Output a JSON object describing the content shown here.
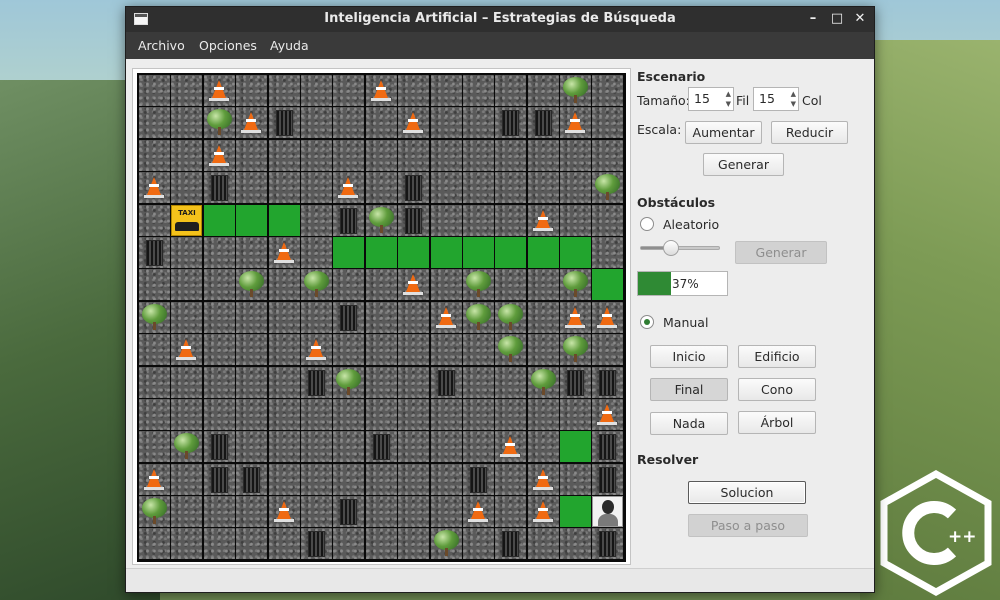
{
  "window": {
    "title": "Inteligencia Artificial – Estrategias de Búsqueda",
    "controls": [
      "minimize",
      "maximize",
      "close"
    ]
  },
  "menu": [
    "Archivo",
    "Opciones",
    "Ayuda"
  ],
  "grid": {
    "rows": 15,
    "cols": 15,
    "legend": {
      ".": "empty",
      "P": "path",
      "C": "cone",
      "T": "tree",
      "B": "building",
      "X": "taxi",
      "F": "person"
    },
    "layout": [
      "..C....C.....T.",
      "..TCB...C..BBC.",
      "..C............",
      "C.B...C.B.....T",
      ".XPPP.BTB...C..",
      "B...C.PPPPPPPP.",
      "...T.T..C.T..TP",
      "T.....B..CTT.CC",
      ".C...C.....T.T.",
      ".....BT..B..TBB",
      "..............C",
      ".TB....B...C.PB",
      "C.BB......B.C.B",
      "T...C.B...C.CPF",
      ".....B...T.B..B"
    ],
    "taxi_label": "TAXI"
  },
  "panel": {
    "escenario_title": "Escenario",
    "tamano_label": "Tamaño:",
    "filas_value": "15",
    "fil_label": "Fil",
    "columnas_value": "15",
    "col_label": "Col",
    "escala_label": "Escala:",
    "aumentar_label": "Aumentar",
    "reducir_label": "Reducir",
    "generar_label": "Generar",
    "obstaculos_title": "Obstáculos",
    "aleatorio_label": "Aleatorio",
    "generar_obstaculos_label": "Generar",
    "progress_text": "37%",
    "progress_value": 0.37,
    "manual_label": "Manual",
    "inicio_label": "Inicio",
    "edificio_label": "Edificio",
    "final_label": "Final",
    "cono_label": "Cono",
    "nada_label": "Nada",
    "arbol_label": "Árbol",
    "resolver_title": "Resolver",
    "solucion_label": "Solucion",
    "paso_label": "Paso a paso",
    "slider_value": 0.38
  },
  "colors": {
    "path_green": "#22a52e",
    "progress_green": "#2f8a34",
    "titlebar": "#2f2f2f"
  }
}
